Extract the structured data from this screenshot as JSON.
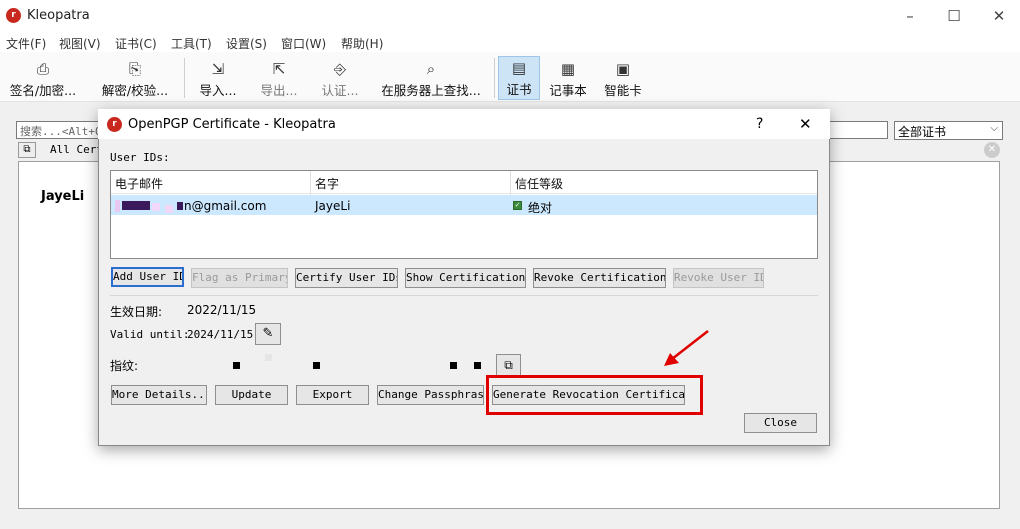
{
  "app": {
    "title": "Kleopatra",
    "icon_letter": "r"
  },
  "window_controls": {
    "minimize": "–",
    "maximize": "☐",
    "close": "✕"
  },
  "menu": [
    "文件(F)",
    "视图(V)",
    "证书(C)",
    "工具(T)",
    "设置(S)",
    "窗口(W)",
    "帮助(H)"
  ],
  "toolbar": [
    {
      "label": "签名/加密...",
      "icon": "sign-encrypt-icon",
      "glyph": "⎙"
    },
    {
      "label": "解密/校验...",
      "icon": "decrypt-verify-icon",
      "glyph": "⎘"
    },
    {
      "label": "导入...",
      "icon": "import-icon",
      "glyph": "⇲"
    },
    {
      "label": "导出...",
      "icon": "export-icon",
      "glyph": "⇱"
    },
    {
      "label": "认证...",
      "icon": "certify-icon",
      "glyph": "⎆"
    },
    {
      "label": "在服务器上查找...",
      "icon": "search-icon",
      "glyph": "⌕"
    },
    {
      "label": "证书",
      "icon": "certificates-icon",
      "glyph": "▤"
    },
    {
      "label": "记事本",
      "icon": "notepad-icon",
      "glyph": "▦"
    },
    {
      "label": "智能卡",
      "icon": "smartcard-icon",
      "glyph": "▣"
    }
  ],
  "search": {
    "placeholder": "搜索...<Alt+Q>"
  },
  "filter_combo": {
    "value": "全部证书",
    "arrow": "⌵"
  },
  "tab": {
    "label": "All Cert",
    "icon": "⧉",
    "close": "✕"
  },
  "main_list": {
    "first_name": "JayeLi"
  },
  "dialog": {
    "title": "OpenPGP Certificate - Kleopatra",
    "help": "?",
    "close_x": "✕",
    "user_ids_label": "User IDs:",
    "columns": [
      "电子邮件",
      "名字",
      "信任等级"
    ],
    "rows": [
      {
        "email": "n@gmail.com",
        "name": "JayeLi",
        "trust": "绝对",
        "trust_check": "✓"
      }
    ],
    "buttons": [
      {
        "label": "Add User ID",
        "state": "focused"
      },
      {
        "label": "Flag as Primary",
        "state": "disabled"
      },
      {
        "label": "Certify User IDs",
        "state": "enabled"
      },
      {
        "label": "Show Certifications",
        "state": "enabled"
      },
      {
        "label": "Revoke Certifications",
        "state": "enabled"
      },
      {
        "label": "Revoke User ID",
        "state": "disabled"
      }
    ],
    "created_label": "生效日期:",
    "created_value": "2022/11/15",
    "valid_label": "Valid until:",
    "valid_value": "2024/11/15",
    "edit_glyph": "✎",
    "fingerprint_label": "指纹:",
    "copy_glyph": "⧉",
    "bottom_buttons": [
      "More Details...",
      "Update",
      "Export",
      "Change Passphrase",
      "Generate Revocation Certificate"
    ],
    "close_button": "Close"
  },
  "annotation_color": "#e00000"
}
